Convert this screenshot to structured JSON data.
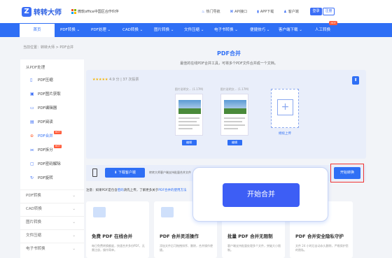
{
  "header": {
    "logo_icon": "Z",
    "logo_text": "转转大师",
    "ms_label": "微软office中国区合作伙伴",
    "links": [
      {
        "icon": "♨",
        "label": "热门导航"
      },
      {
        "icon": "⌘",
        "label": "API接口"
      },
      {
        "icon": "▮",
        "label": "APP下载"
      },
      {
        "icon": "♟",
        "label": "客户端"
      }
    ],
    "login": "登录",
    "register": "注册"
  },
  "nav": {
    "home": "首页",
    "items": [
      "PDF转换 ⌄",
      "PDF处理 ⌄",
      "CAD转换 ⌄",
      "图片转换 ⌄",
      "文件压缩 ⌄",
      "电子书转换 ⌄",
      "便捷技巧 ⌄",
      "客户端下载 ⌄",
      "人工转换"
    ],
    "hot": "HOT"
  },
  "breadcrumb": "当前位置：转转大师 > PDF合并",
  "sidebar": {
    "heading": "从PDF处理",
    "items": [
      {
        "icon": "▯",
        "label": "PDF压缩"
      },
      {
        "icon": "▣",
        "label": "PDF图片获取"
      },
      {
        "icon": "▭",
        "label": "PDF编辑器"
      },
      {
        "icon": "▤",
        "label": "PDF阅读"
      },
      {
        "icon": "⊕",
        "label": "PDF合并"
      },
      {
        "icon": "⫘",
        "label": "PDF拆分"
      },
      {
        "icon": "▢",
        "label": "PDF密码解除"
      },
      {
        "icon": "↻",
        "label": "PDF旋转"
      }
    ],
    "categories": [
      "PDF转换",
      "CAD转换",
      "图片转换",
      "文件压缩",
      "电子书转换"
    ],
    "hot": "HOT"
  },
  "main": {
    "title": "PDF合并",
    "subtitle": "最佳的在线PDF合并工具，可将多个PDF文件合并成一个文档。",
    "rating": "4.9 分 | 37 次投票",
    "stars": "★★★★★",
    "files": [
      {
        "name": "图片说明文... (1.17M)",
        "edit": "编辑"
      },
      {
        "name": "图片说明文... (1.17M)",
        "edit": "编辑"
      }
    ],
    "add_label": "继续上传",
    "add_plus": "+",
    "download_btn": "⬇ 下载客户端",
    "download_desc": "转转大师客户端支持批量合并文件",
    "convert_btn": "开始转换",
    "notice_prefix": "注意：如果PDF是包含",
    "notice_link1": "密码",
    "notice_mid": "请先上传，了解更多关于",
    "notice_link2": "PDF合并的使用方法",
    "cards": [
      {
        "title": "免费 PDF 在线合并",
        "desc": "每日免费转换额度，快速合并多份PDF，无需注册，操作简单。"
      },
      {
        "title": "PDF 合并灵活操作",
        "desc": "添加文件后可拖拽排序、删除，合并操作便捷。"
      },
      {
        "title": "批量 PDF 合并无限制",
        "desc": "客户端支持批量处理多个文件，突破大小限制。"
      },
      {
        "title": "PDF 合并安全隐私守护",
        "desc": "文件 24 小时后自动永久删除，严格保护您的隐私。"
      }
    ]
  },
  "popup": {
    "button": "开始合并"
  }
}
